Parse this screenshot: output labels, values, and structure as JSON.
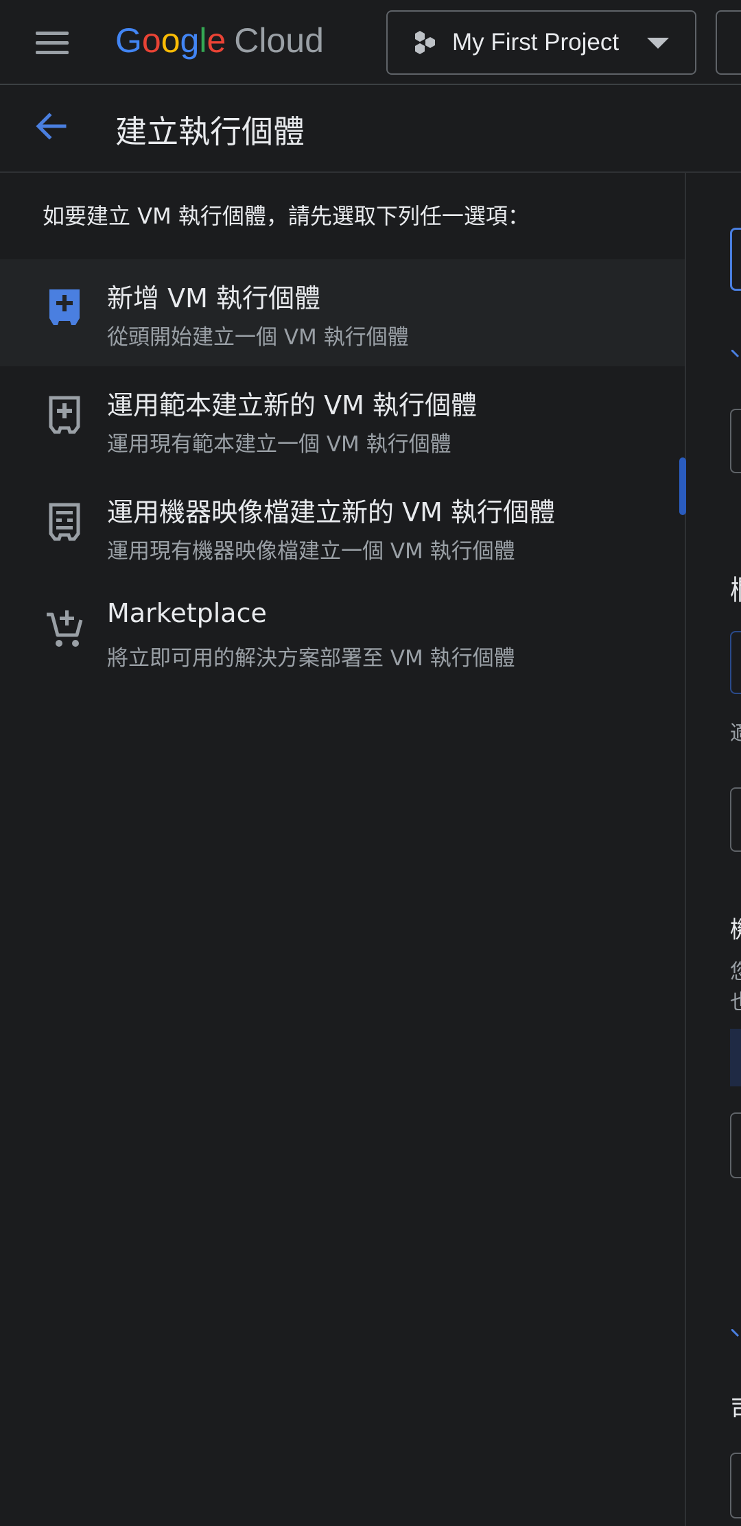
{
  "topbar": {
    "logo_google": "Google",
    "logo_cloud": "Cloud",
    "project_name": "My First Project"
  },
  "header": {
    "title": "建立執行個體"
  },
  "left_panel": {
    "intro": "如要建立 VM 執行個體，請先選取下列任一選項：",
    "options": [
      {
        "title": "新增 VM 執行個體",
        "subtitle": "從頭開始建立一個 VM 執行個體",
        "icon": "add-box-icon",
        "selected": true
      },
      {
        "title": "運用範本建立新的 VM 執行個體",
        "subtitle": "運用現有範本建立一個 VM 執行個體",
        "icon": "template-icon",
        "selected": false
      },
      {
        "title": "運用機器映像檔建立新的 VM 執行個體",
        "subtitle": "運用現有機器映像檔建立一個 VM 執行個體",
        "icon": "machine-image-icon",
        "selected": false
      },
      {
        "title": "Marketplace",
        "subtitle": "將立即可用的解決方案部署至 VM 執行個體",
        "icon": "shopping-cart-icon",
        "selected": false
      }
    ]
  },
  "right_panel_fragments": {
    "glyph_1": "欄",
    "glyph_2": "適",
    "glyph_3": "機",
    "glyph_4": "您",
    "glyph_5": "也",
    "glyph_6": "司"
  },
  "colors": {
    "background": "#1b1c1e",
    "accent_blue": "#4a7fe0",
    "selected_row": "#222426",
    "secondary_text": "#9aa0a6"
  }
}
